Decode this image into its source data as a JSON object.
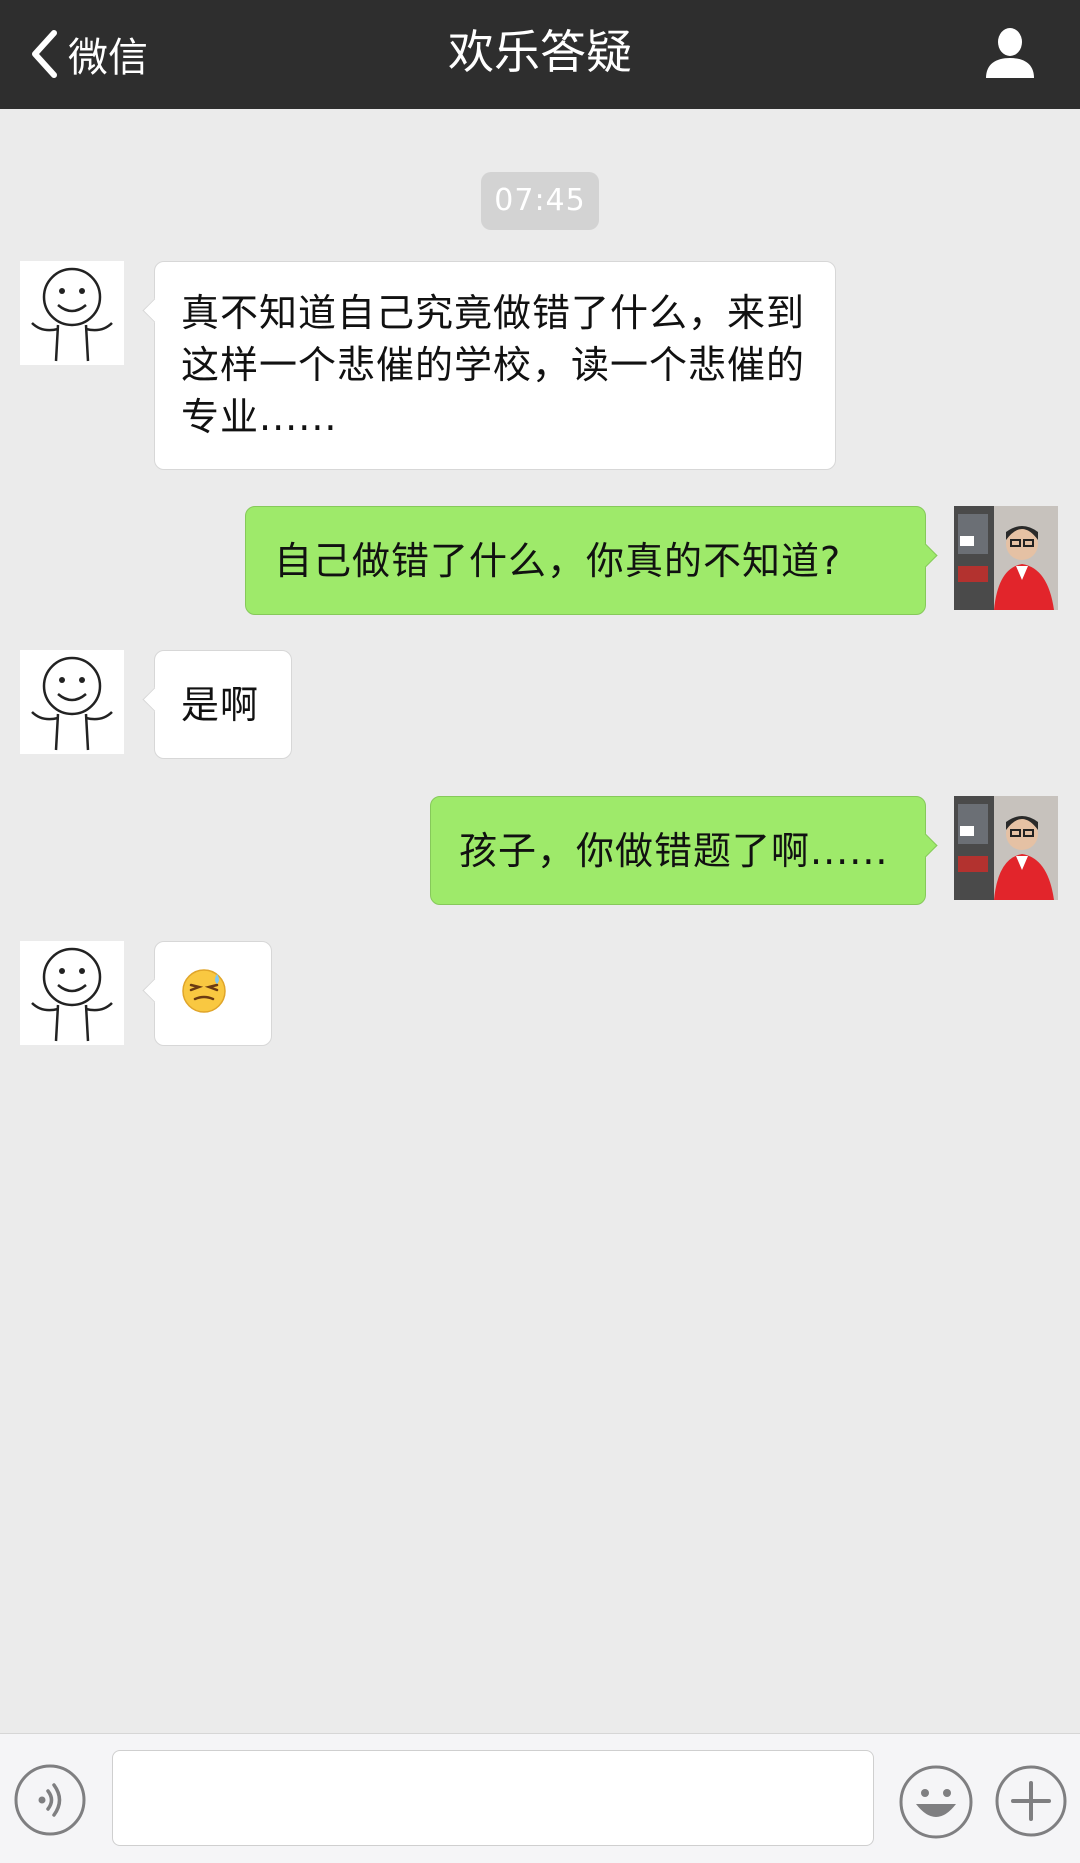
{
  "header": {
    "back_label": "微信",
    "title": "欢乐答疑"
  },
  "chat": {
    "timestamp": "07:45",
    "messages": [
      {
        "side": "in",
        "text": "真不知道自己究竟做错了什么，来到这样一个悲催的学校，读一个悲催的专业......"
      },
      {
        "side": "out",
        "text": "自己做错了什么，你真的不知道?"
      },
      {
        "side": "in",
        "text": "是啊"
      },
      {
        "side": "out",
        "text": "孩子，你做错题了啊......"
      },
      {
        "side": "in",
        "emoji": "awkward-sweat-emoji"
      }
    ]
  },
  "input": {
    "value": ""
  },
  "colors": {
    "nav_bg": "#2e2e2e",
    "chat_bg": "#ebebeb",
    "outgoing_bubble": "#9eea6a",
    "incoming_bubble": "#ffffff"
  }
}
